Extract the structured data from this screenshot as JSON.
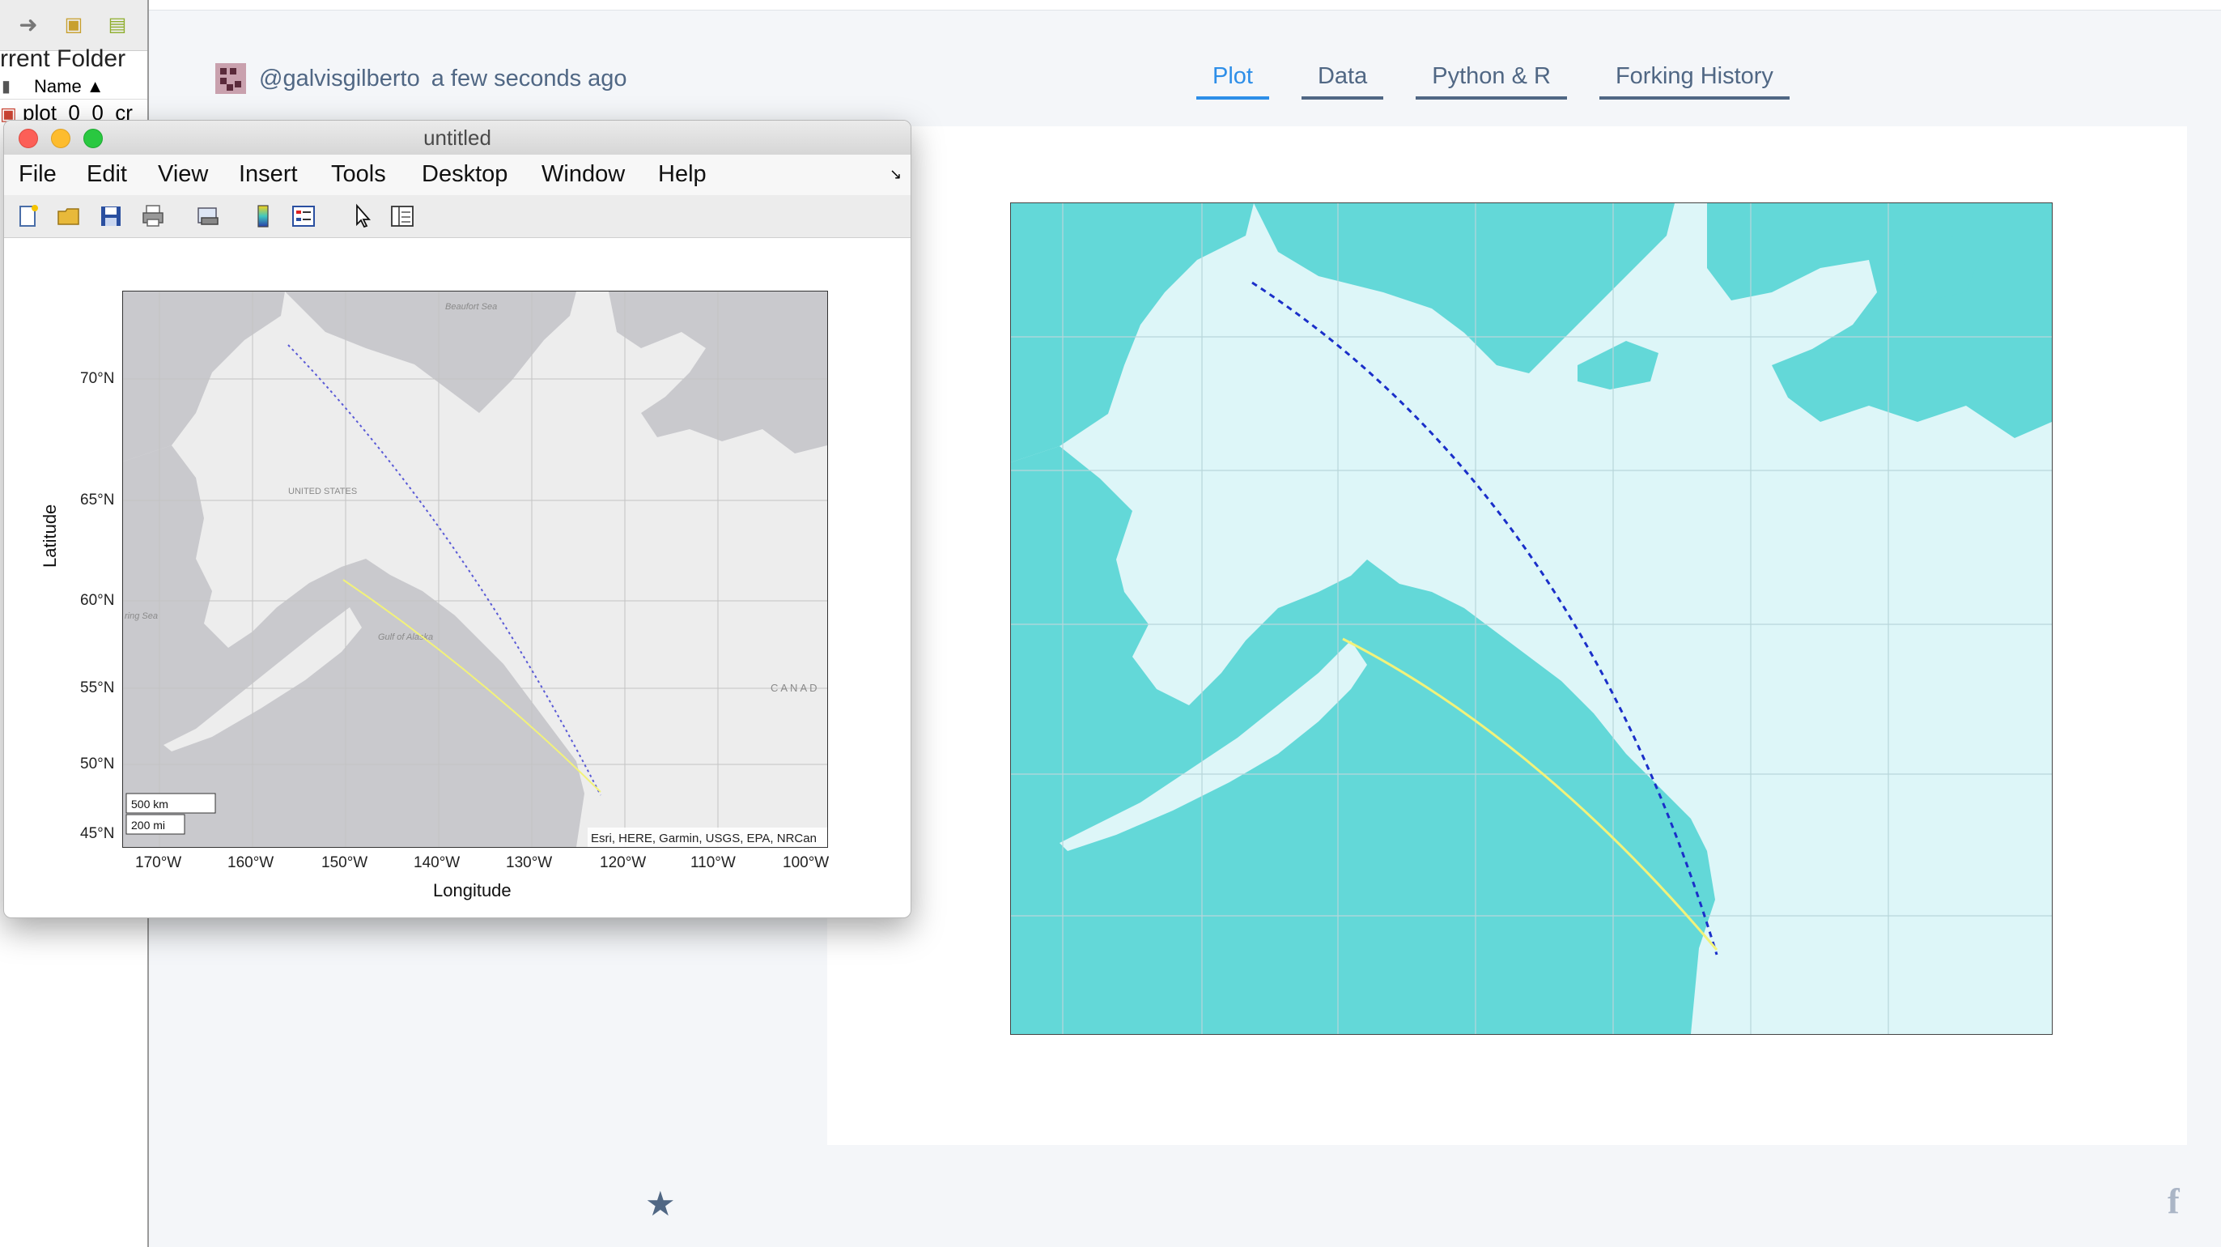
{
  "matlab_panel": {
    "folder_label": "rrent Folder",
    "name_header": "Name ▲",
    "file_item": "plot_0_0_cr"
  },
  "plotly": {
    "username": "@galvisgilberto",
    "timestamp": "a few seconds ago",
    "tabs": [
      {
        "label": "Plot",
        "active": true
      },
      {
        "label": "Data",
        "active": false
      },
      {
        "label": "Python & R",
        "active": false
      },
      {
        "label": "Forking History",
        "active": false
      }
    ],
    "colors": {
      "ocean": "#63d8d8",
      "land": "#ddf6f8",
      "route_dotted": "#1a2fc9",
      "route_solid": "#f2f27a",
      "accent": "#2d8ee8",
      "text": "#506784"
    }
  },
  "figure": {
    "title": "untitled",
    "menus": [
      "File",
      "Edit",
      "View",
      "Insert",
      "Tools",
      "Desktop",
      "Window",
      "Help"
    ],
    "toolbar_icons": [
      "new-figure-icon",
      "open-icon",
      "save-icon",
      "print-icon",
      "link-icon",
      "colorbar-icon",
      "legend-icon",
      "pointer-icon",
      "property-editor-icon"
    ],
    "ylabel": "Latitude",
    "xlabel": "Longitude",
    "lat_ticks": [
      "70°N",
      "65°N",
      "60°N",
      "55°N",
      "50°N",
      "45°N"
    ],
    "lon_ticks": [
      "170°W",
      "160°W",
      "150°W",
      "140°W",
      "130°W",
      "120°W",
      "110°W",
      "100°W"
    ],
    "scale_km": "500 km",
    "scale_mi": "200 mi",
    "attribution": "Esri, HERE, Garmin, USGS, EPA, NRCan",
    "map_labels": [
      "Beaufort Sea",
      "UNITED STATES",
      "Gulf of Alaska",
      "CANAD",
      "ring Sea"
    ],
    "colors": {
      "ocean": "#c9c9cd",
      "land": "#ededed",
      "route_dotted": "#5a5ad6",
      "route_solid": "#f2f27a"
    }
  }
}
